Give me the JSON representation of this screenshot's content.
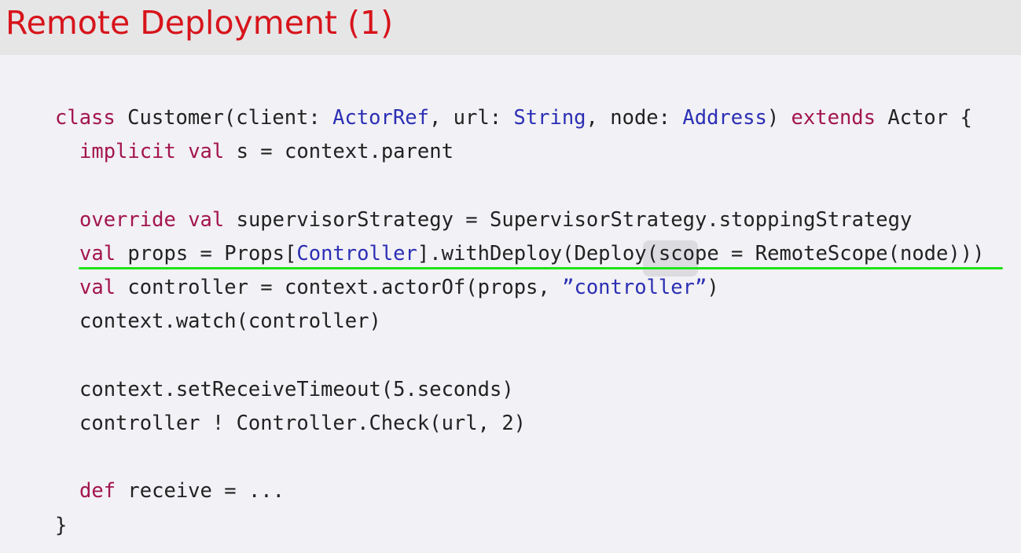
{
  "slide": {
    "title": "Remote Deployment (1)"
  },
  "colors": {
    "title": "#d7141b",
    "keyword": "#a3154f",
    "type": "#2b2fb4",
    "text": "#222222",
    "highlight_underline": "#1ee41b"
  },
  "code": {
    "l1": {
      "kw_class": "class",
      "p1": " Customer(client: ",
      "t_actorref": "ActorRef",
      "p2": ", url: ",
      "t_string": "String",
      "p3": ", node: ",
      "t_address": "Address",
      "p4": ") ",
      "kw_extends": "extends",
      "p5": " Actor {"
    },
    "l2": {
      "kw_implicit": "implicit",
      "sp": " ",
      "kw_val": "val",
      "p1": " s = context.parent"
    },
    "l3": {
      "kw_override": "override",
      "sp": " ",
      "kw_val": "val",
      "p1": " supervisorStrategy = SupervisorStrategy.stoppingStrategy"
    },
    "l4": {
      "kw_val": "val",
      "p1": " props = Props[",
      "t_controller": "Controller",
      "p2": "].withDeploy(Deploy(scope = RemoteScope(node)))"
    },
    "l5": {
      "kw_val": "val",
      "p1": " controller = context.actorOf(props, ",
      "s_controller": "”controller”",
      "p2": ")"
    },
    "l6": "context.watch(controller)",
    "l7": "context.setReceiveTimeout(5.seconds)",
    "l8": "controller ! Controller.Check(url, 2)",
    "l9": {
      "kw_def": "def",
      "p1": " receive = ..."
    },
    "l10": "}"
  }
}
